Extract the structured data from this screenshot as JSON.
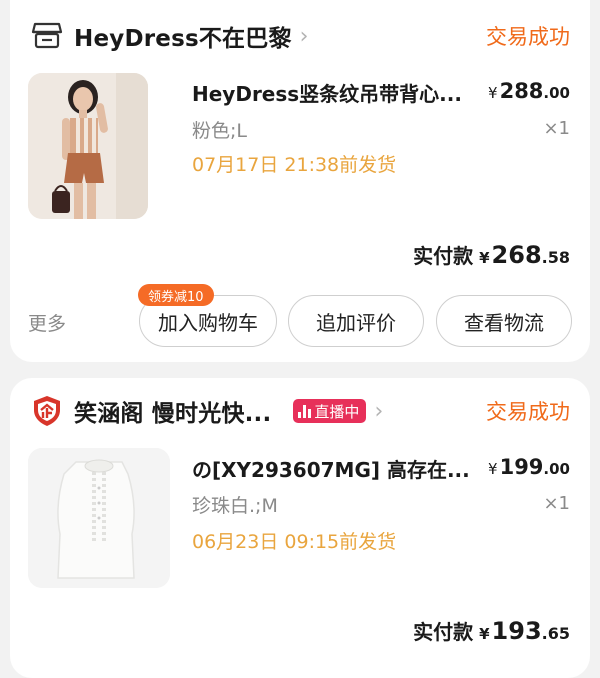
{
  "orders": [
    {
      "shop_name": "HeyDress不在巴黎",
      "status": "交易成功",
      "item": {
        "title": "HeyDress竖条纹吊带背心...",
        "price_yen": "¥",
        "price_int": "288",
        "price_dec": ".00",
        "variant": "粉色;L",
        "qty": "×1",
        "ship_time": "07月17日 21:38前发货"
      },
      "paid": {
        "label": "实付款",
        "yen": "¥",
        "int": "268",
        "dec": ".58"
      },
      "actions": {
        "more": "更多",
        "coupon_badge": "领券减10",
        "add_cart": "加入购物车",
        "add_review": "追加评价",
        "view_logistics": "查看物流"
      }
    },
    {
      "shop_name": "笑涵阁 慢时光快...",
      "live_badge": "直播中",
      "status": "交易成功",
      "item": {
        "title": "の[XY293607MG] 高存在...",
        "price_yen": "¥",
        "price_int": "199",
        "price_dec": ".00",
        "variant": "珍珠白.;M",
        "qty": "×1",
        "ship_time": "06月23日 09:15前发货"
      },
      "paid": {
        "label": "实付款",
        "yen": "¥",
        "int": "193",
        "dec": ".65"
      }
    }
  ],
  "colors": {
    "accent": "#f06a1a",
    "ship": "#e9a53e",
    "live": "#e7305a",
    "coupon": "#f56b26"
  }
}
